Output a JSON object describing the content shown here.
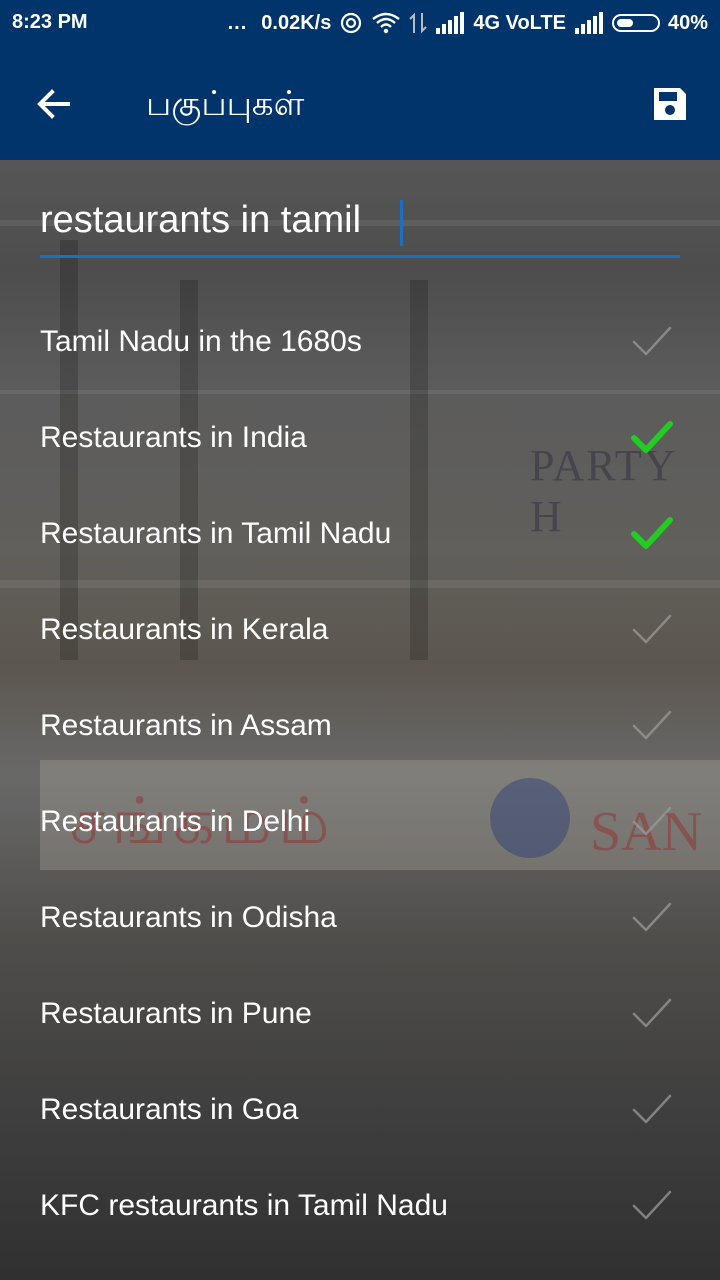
{
  "status_bar": {
    "time": "8:23 PM",
    "dots": "...",
    "speed": "0.02K/s",
    "network": "4G VoLTE",
    "battery": "40%"
  },
  "app_bar": {
    "title": "பகுப்புகள்",
    "back_icon": "arrow-back-icon",
    "save_icon": "floppy-disk-icon"
  },
  "search": {
    "value": "restaurants in tamil",
    "accent_color": "#1e6fc0"
  },
  "categories": [
    {
      "label": "Tamil Nadu in the 1680s",
      "checked": false
    },
    {
      "label": "Restaurants in India",
      "checked": true
    },
    {
      "label": "Restaurants in Tamil Nadu",
      "checked": true
    },
    {
      "label": "Restaurants in Kerala",
      "checked": false
    },
    {
      "label": "Restaurants in Assam",
      "checked": false
    },
    {
      "label": "Restaurants in Delhi",
      "checked": false
    },
    {
      "label": "Restaurants in Odisha",
      "checked": false
    },
    {
      "label": "Restaurants in Pune",
      "checked": false
    },
    {
      "label": "Restaurants in Goa",
      "checked": false
    },
    {
      "label": "KFC restaurants in Tamil Nadu",
      "checked": false
    }
  ],
  "colors": {
    "app_bar": "#01346b",
    "check_on": "#22cc22",
    "check_off": "#9a9a9a"
  }
}
